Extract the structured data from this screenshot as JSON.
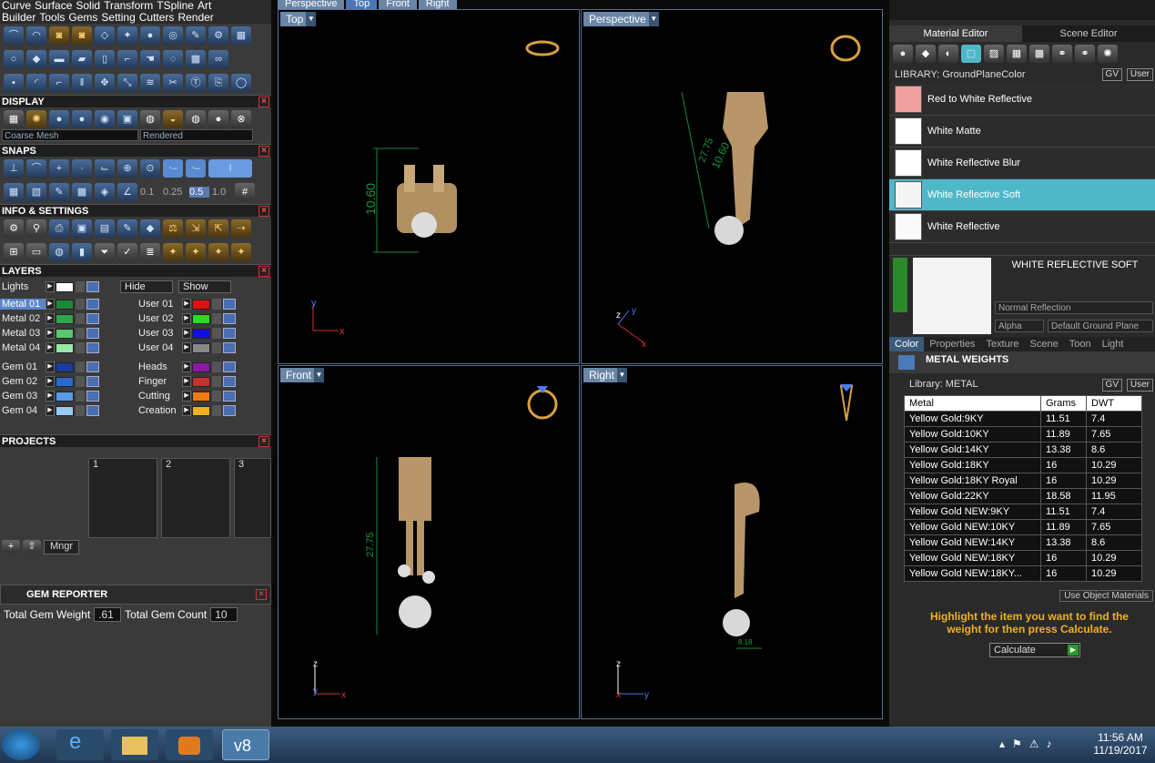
{
  "menu": {
    "row1": [
      "Curve",
      "Surface",
      "Solid",
      "Transform",
      "TSpline",
      "Art"
    ],
    "row2": [
      "Builder",
      "Tools",
      "Gems",
      "Setting",
      "Cutters",
      "Render"
    ]
  },
  "display": {
    "title": "DISPLAY",
    "mesh": "Coarse Mesh",
    "render": "Rendered"
  },
  "snaps": {
    "title": "SNAPS",
    "values": [
      "0.1",
      "0.25",
      "0.5",
      "1.0"
    ]
  },
  "info": {
    "title": "INFO & SETTINGS"
  },
  "layers": {
    "title": "LAYERS",
    "lights": "Lights",
    "hide": "Hide",
    "show": "Show",
    "left": [
      {
        "name": "Metal 01",
        "color": "#1c8a3a"
      },
      {
        "name": "Metal 02",
        "color": "#2aa84a"
      },
      {
        "name": "Metal 03",
        "color": "#5ac870"
      },
      {
        "name": "Metal 04",
        "color": "#9ae8a8"
      },
      {
        "name": "Gem 01",
        "color": "#1a3c9a"
      },
      {
        "name": "Gem 02",
        "color": "#2a6ad0"
      },
      {
        "name": "Gem 03",
        "color": "#5a9ae8"
      },
      {
        "name": "Gem 04",
        "color": "#9ac8f8"
      }
    ],
    "right": [
      {
        "name": "User 01",
        "color": "#e01010"
      },
      {
        "name": "User 02",
        "color": "#20e020"
      },
      {
        "name": "User 03",
        "color": "#1010e0"
      },
      {
        "name": "User 04",
        "color": "#888888"
      },
      {
        "name": "Heads",
        "color": "#8a1aa8"
      },
      {
        "name": "Finger",
        "color": "#c83030"
      },
      {
        "name": "Cutting",
        "color": "#f07a10"
      },
      {
        "name": "Creation",
        "color": "#f0b020"
      }
    ]
  },
  "projects": {
    "title": "PROJECTS",
    "slots": [
      "1",
      "2",
      "3"
    ],
    "mngr": "Mngr"
  },
  "gem_reporter": {
    "title": "GEM REPORTER",
    "weight_label": "Total Gem Weight",
    "weight": ".61",
    "count_label": "Total Gem Count",
    "count": "10"
  },
  "viewport_tabs": [
    "Perspective",
    "Top",
    "Front",
    "Right"
  ],
  "views": {
    "top": "Top",
    "perspective": "Perspective",
    "front": "Front",
    "right": "Right",
    "dim_top": "10.60",
    "dim_persp_a": "27.75",
    "dim_persp_b": "10.60",
    "dim_front": "27.75",
    "dim_right": "8.18"
  },
  "right_panel": {
    "tab_material": "Material Editor",
    "tab_scene": "Scene Editor",
    "library": "LIBRARY: GroundPlaneColor",
    "gv": "GV",
    "user": "User",
    "materials": [
      {
        "name": "Red to White Reflective",
        "color": "#f0a0a0"
      },
      {
        "name": "White Matte",
        "color": "#ffffff"
      },
      {
        "name": "White Reflective Blur",
        "color": "#ffffff"
      },
      {
        "name": "White Reflective Soft",
        "color": "#f4f4f4"
      },
      {
        "name": "White Reflective",
        "color": "#fafafa"
      }
    ],
    "selected_title": "WHITE REFLECTIVE SOFT",
    "reflection": "Normal Reflection",
    "alpha": "Alpha",
    "ground": "Default Ground Plane",
    "subtabs": [
      "Color",
      "Properties",
      "Texture",
      "Scene",
      "Toon",
      "Light"
    ],
    "metal_title": "METAL WEIGHTS",
    "metal_library": "Library: METAL",
    "headers": [
      "Metal",
      "Grams",
      "DWT"
    ],
    "rows": [
      [
        "Yellow Gold:9KY",
        "11.51",
        "7.4"
      ],
      [
        "Yellow Gold:10KY",
        "11.89",
        "7.65"
      ],
      [
        "Yellow Gold:14KY",
        "13.38",
        "8.6"
      ],
      [
        "Yellow Gold:18KY",
        "16",
        "10.29"
      ],
      [
        "Yellow Gold:18KY Royal",
        "16",
        "10.29"
      ],
      [
        "Yellow Gold:22KY",
        "18.58",
        "11.95"
      ],
      [
        "Yellow Gold NEW:9KY",
        "11.51",
        "7.4"
      ],
      [
        "Yellow Gold NEW:10KY",
        "11.89",
        "7.65"
      ],
      [
        "Yellow Gold NEW:14KY",
        "13.38",
        "8.6"
      ],
      [
        "Yellow Gold NEW:18KY",
        "16",
        "10.29"
      ],
      [
        "Yellow Gold NEW:18KY...",
        "16",
        "10.29"
      ]
    ],
    "use_obj": "Use Object Materials",
    "hint": "Highlight the item you want to find the weight for then press Calculate.",
    "calculate": "Calculate"
  },
  "taskbar": {
    "time": "11:56 AM",
    "date": "11/19/2017",
    "app": "v8"
  }
}
